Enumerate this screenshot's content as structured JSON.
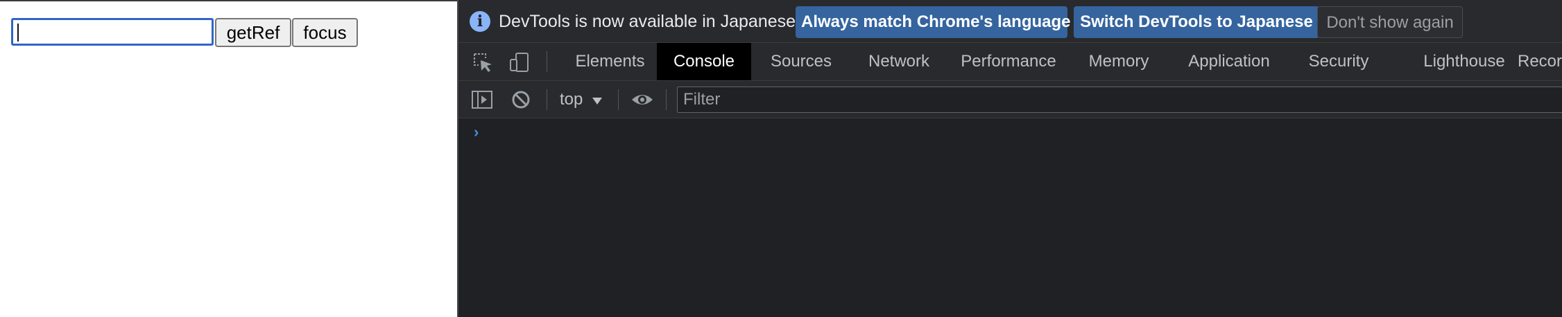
{
  "page": {
    "input_value": "",
    "buttons": {
      "getref": "getRef",
      "focus": "focus"
    }
  },
  "devtools": {
    "infobar": {
      "icon": "info-icon",
      "message": "DevTools is now available in Japanese!",
      "match_language": "Always match Chrome's language",
      "switch_language": "Switch DevTools to Japanese",
      "dont_show": "Don't show again"
    },
    "tabs": [
      {
        "label": "Elements",
        "active": false
      },
      {
        "label": "Console",
        "active": true
      },
      {
        "label": "Sources",
        "active": false
      },
      {
        "label": "Network",
        "active": false
      },
      {
        "label": "Performance",
        "active": false
      },
      {
        "label": "Memory",
        "active": false
      },
      {
        "label": "Application",
        "active": false
      },
      {
        "label": "Security",
        "active": false
      },
      {
        "label": "Lighthouse",
        "active": false
      },
      {
        "label": "Recor",
        "active": false
      }
    ],
    "console_toolbar": {
      "context": "top",
      "filter_placeholder": "Filter"
    },
    "prompt_symbol": "›",
    "colors": {
      "panel_bg": "#202124",
      "toolbar_bg": "#292a2d",
      "accent_button": "#35649e",
      "active_tab": "#000000",
      "prompt": "#4b8ae3"
    }
  }
}
